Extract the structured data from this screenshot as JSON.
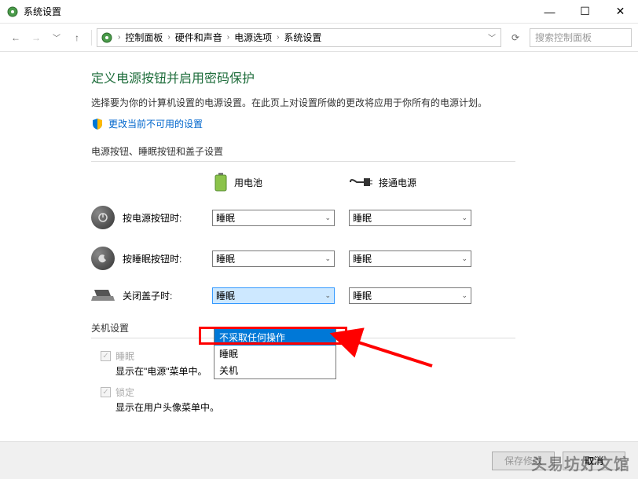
{
  "titlebar": {
    "title": "系统设置"
  },
  "breadcrumb": {
    "items": [
      "控制面板",
      "硬件和声音",
      "电源选项",
      "系统设置"
    ]
  },
  "search": {
    "placeholder": "搜索控制面板"
  },
  "page": {
    "title": "定义电源按钮并启用密码保护",
    "desc": "选择要为你的计算机设置的电源设置。在此页上对设置所做的更改将应用于你所有的电源计划。",
    "change_link": "更改当前不可用的设置"
  },
  "sections": {
    "buttons_lid": "电源按钮、睡眠按钮和盖子设置",
    "shutdown": "关机设置"
  },
  "headers": {
    "battery": "用电池",
    "plugged": "接通电源"
  },
  "rows": {
    "power_button": {
      "label": "按电源按钮时:",
      "battery": "睡眠",
      "plugged": "睡眠"
    },
    "sleep_button": {
      "label": "按睡眠按钮时:",
      "battery": "睡眠",
      "plugged": "睡眠"
    },
    "lid_close": {
      "label": "关闭盖子时:",
      "battery": "睡眠",
      "plugged": "睡眠"
    }
  },
  "dropdown": {
    "options": [
      "不采取任何操作",
      "睡眠",
      "关机"
    ],
    "selected_index": 0
  },
  "shutdown": {
    "sleep": {
      "label": "睡眠",
      "desc": "显示在\"电源\"菜单中。"
    },
    "lock": {
      "label": "锁定",
      "desc": "显示在用户头像菜单中。"
    }
  },
  "buttons": {
    "save": "保存修改",
    "cancel": "取消"
  },
  "watermark": "头易坊好文馆"
}
